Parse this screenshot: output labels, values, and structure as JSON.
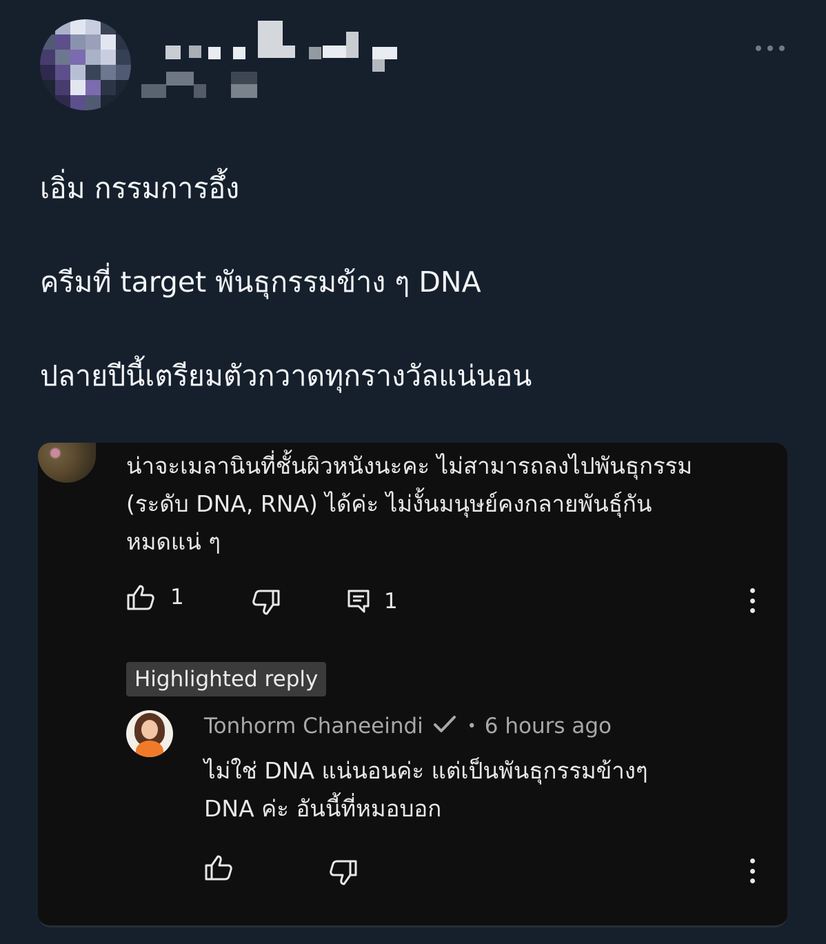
{
  "tweet": {
    "lines": [
      "เอิ่ม กรรมการอึ้ง",
      "ครีมที่ target พันธุกรรมข้าง ๆ DNA",
      "ปลายปีนี้เตรียมตัวกวาดทุกรางวัลแน่นอน"
    ],
    "author": {
      "name_obscured": true,
      "handle_obscured": true
    },
    "more_icon": "more-horizontal-icon"
  },
  "embed": {
    "comment": {
      "lines": [
        "น่าจะเมลานินที่ชั้นผิวหนังนะคะ ไม่สามารถลงไปพันธุกรรม",
        "(ระดับ DNA, RNA) ได้ค่ะ ไม่งั้นมนุษย์คงกลายพันธุ์กัน",
        "หมดแน่ ๆ"
      ],
      "like_count": "1",
      "reply_count": "1"
    },
    "highlighted_label": "Highlighted reply",
    "reply": {
      "author": "Tonhorm Chaneeindi",
      "separator": "•",
      "time": "6 hours ago",
      "lines": [
        "ไม่ใช่ DNA แน่นอนค่ะ แต่เป็นพันธุกรรมข้างๆ",
        "DNA ค่ะ อันนี้ที่หมอบอก"
      ]
    }
  },
  "colors": {
    "page_bg": "#16202d",
    "embed_bg": "#0f0f0f",
    "text": "#f3f5f7",
    "muted": "#a8a8a8",
    "badge_bg": "#3b3b3b"
  }
}
